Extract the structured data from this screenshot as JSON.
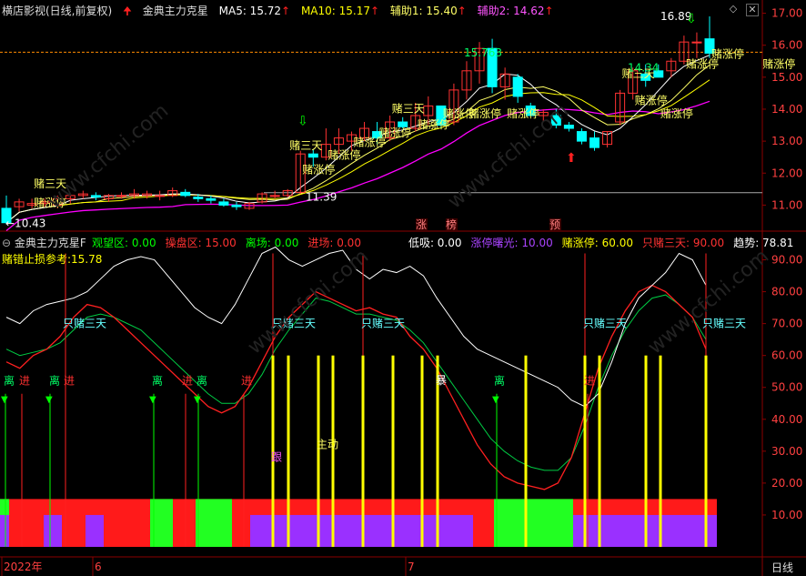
{
  "app_title": "横店影视(日线,前复权)",
  "main_panel": {
    "indicator_name": "金典主力克星",
    "ma5": "MA5: 15.72",
    "ma10": "MA10: 15.17",
    "aux1": "辅助1: 15.40",
    "aux2": "辅助2: 14.62",
    "y_ticks": [
      "17.00",
      "16.00",
      "15.00",
      "14.00",
      "13.00",
      "12.00",
      "11.00"
    ],
    "ylim": [
      10.3,
      17.3
    ],
    "horizontal_ref_level": 15.78,
    "support_level": 11.39,
    "max_label": "16.89",
    "min_label": "10.43",
    "mid_label": "15.763",
    "right_label": "14.34",
    "low_label": "11.39",
    "candles": [
      [
        10.9,
        11.3,
        10.4,
        10.45
      ],
      [
        10.95,
        11.2,
        10.8,
        11.1
      ],
      [
        11.0,
        11.2,
        10.9,
        11.05
      ],
      [
        11.05,
        11.2,
        10.95,
        11.1
      ],
      [
        11.0,
        11.3,
        10.9,
        11.2
      ],
      [
        11.2,
        11.35,
        11.05,
        11.3
      ],
      [
        11.3,
        11.45,
        11.2,
        11.35
      ],
      [
        11.3,
        11.4,
        11.15,
        11.25
      ],
      [
        11.2,
        11.35,
        11.1,
        11.3
      ],
      [
        11.3,
        11.4,
        11.2,
        11.3
      ],
      [
        11.3,
        11.5,
        11.2,
        11.35
      ],
      [
        11.3,
        11.45,
        11.2,
        11.35
      ],
      [
        11.3,
        11.45,
        11.15,
        11.3
      ],
      [
        11.3,
        11.55,
        11.25,
        11.45
      ],
      [
        11.4,
        11.5,
        11.25,
        11.3
      ],
      [
        11.25,
        11.35,
        11.1,
        11.2
      ],
      [
        11.2,
        11.3,
        11.05,
        11.15
      ],
      [
        11.1,
        11.2,
        10.95,
        11.0
      ],
      [
        11.0,
        11.1,
        10.85,
        10.95
      ],
      [
        10.9,
        11.1,
        10.85,
        11.05
      ],
      [
        11.1,
        11.4,
        11.05,
        11.35
      ],
      [
        11.3,
        11.45,
        11.2,
        11.3
      ],
      [
        11.3,
        11.5,
        11.25,
        11.45
      ],
      [
        11.4,
        12.7,
        11.35,
        12.6
      ],
      [
        12.6,
        12.75,
        12.2,
        12.5
      ],
      [
        12.5,
        13.4,
        12.4,
        12.9
      ],
      [
        12.9,
        13.4,
        12.6,
        13.1
      ],
      [
        13.0,
        13.3,
        12.7,
        13.2
      ],
      [
        13.1,
        13.6,
        13.0,
        13.4
      ],
      [
        13.3,
        13.6,
        12.9,
        13.1
      ],
      [
        13.1,
        13.8,
        13.0,
        13.6
      ],
      [
        13.6,
        13.75,
        13.4,
        13.45
      ],
      [
        13.4,
        14.2,
        13.3,
        13.8
      ],
      [
        13.8,
        14.4,
        13.5,
        14.1
      ],
      [
        14.1,
        14.1,
        13.4,
        13.5
      ],
      [
        13.6,
        14.8,
        13.5,
        14.6
      ],
      [
        14.6,
        15.5,
        14.3,
        15.2
      ],
      [
        15.2,
        16.1,
        14.8,
        15.9
      ],
      [
        15.9,
        16.2,
        14.5,
        14.7
      ],
      [
        14.7,
        15.3,
        14.3,
        15.1
      ],
      [
        15.0,
        15.1,
        14.2,
        14.4
      ],
      [
        14.1,
        14.2,
        13.8,
        13.8
      ],
      [
        13.8,
        14.0,
        13.6,
        13.9
      ],
      [
        13.8,
        14.0,
        13.4,
        13.5
      ],
      [
        13.5,
        13.6,
        13.3,
        13.4
      ],
      [
        13.3,
        13.4,
        12.9,
        13.0
      ],
      [
        13.1,
        13.3,
        12.7,
        12.8
      ],
      [
        12.9,
        13.3,
        12.8,
        13.3
      ],
      [
        13.6,
        14.6,
        13.5,
        14.5
      ],
      [
        14.5,
        15.3,
        14.3,
        15.2
      ],
      [
        15.1,
        15.4,
        14.7,
        14.9
      ],
      [
        15.2,
        15.4,
        15.0,
        15.0
      ],
      [
        15.2,
        15.6,
        15.0,
        15.5
      ],
      [
        15.5,
        16.3,
        15.4,
        16.1
      ],
      [
        16.1,
        16.4,
        15.6,
        16.1
      ],
      [
        16.2,
        16.9,
        15.6,
        15.75
      ]
    ],
    "signal_labels": [
      {
        "text": "赌三天",
        "i": 3,
        "p": 11.55
      },
      {
        "text": "赌涨停",
        "i": 3,
        "p": 10.95
      },
      {
        "text": "赌三天",
        "i": 23,
        "p": 12.75
      },
      {
        "text": "赌涨停",
        "i": 24,
        "p": 12.0
      },
      {
        "text": "赌涨停",
        "i": 26,
        "p": 12.45
      },
      {
        "text": "赌涨停",
        "i": 28,
        "p": 12.85
      },
      {
        "text": "赌涨停",
        "i": 30,
        "p": 13.15
      },
      {
        "text": "赌三天",
        "i": 31,
        "p": 13.9
      },
      {
        "text": "赌涨停",
        "i": 33,
        "p": 13.4
      },
      {
        "text": "赌涨停",
        "i": 35,
        "p": 13.75
      },
      {
        "text": "赌涨停",
        "i": 37,
        "p": 13.75
      },
      {
        "text": "赌涨停",
        "i": 40,
        "p": 13.75
      },
      {
        "text": "赌三天",
        "i": 49,
        "p": 15.0
      },
      {
        "text": "赌涨停",
        "i": 50,
        "p": 14.15
      },
      {
        "text": "赌涨停",
        "i": 54,
        "p": 15.3
      },
      {
        "text": "赌涨停",
        "i": 56,
        "p": 15.6
      },
      {
        "text": "赌涨停",
        "i": 60,
        "p": 15.3
      },
      {
        "text": "赌涨停",
        "i": 52,
        "p": 13.75
      }
    ],
    "markers": [
      {
        "text": "涨",
        "x": 463
      },
      {
        "text": "榜",
        "x": 496
      },
      {
        "text": "预",
        "x": 610
      }
    ],
    "colors": {
      "up": "#ff3232",
      "down": "#00ffff",
      "ma5": "#ffffff",
      "ma10": "#ffff00",
      "aux1": "#ffff66",
      "aux2": "#ff00ff",
      "grid": "#8b0000",
      "ref": "#ff8c00"
    }
  },
  "sub_panel": {
    "indicator_name": "金典主力克星F",
    "fields": [
      {
        "label": "观望区: 0.00",
        "color": "#00ff00"
      },
      {
        "label": "操盘区: 15.00",
        "color": "#ff3232"
      },
      {
        "label": "离场: 0.00",
        "color": "#00ff00"
      },
      {
        "label": "进场: 0.00",
        "color": "#ff3232"
      },
      {
        "label": "低吸: 0.00",
        "color": "#ffffff"
      },
      {
        "label": "涨停曙光: 10.00",
        "color": "#aa44ff"
      },
      {
        "label": "赌涨停: 60.00",
        "color": "#ffff00"
      },
      {
        "label": "只赌三天: 90.00",
        "color": "#ff3232"
      },
      {
        "label": "趋势: 78.81",
        "color": "#ffffff"
      }
    ],
    "stop_ref": "赌错止损参考:15.78",
    "y_ticks": [
      "90.00",
      "80.00",
      "70.00",
      "60.00",
      "50.00",
      "40.00",
      "30.00",
      "20.00",
      "10.00"
    ],
    "ylim": [
      -2,
      95
    ],
    "trend_white": [
      72,
      70,
      74,
      76,
      77,
      78,
      80,
      84,
      88,
      90,
      91,
      90,
      85,
      80,
      75,
      72,
      70,
      76,
      84,
      92,
      94,
      90,
      88,
      90,
      92,
      93,
      87,
      84,
      87,
      86,
      88,
      85,
      78,
      72,
      66,
      62,
      60,
      58,
      56,
      54,
      52,
      50,
      46,
      44,
      48,
      58,
      70,
      78,
      82,
      86,
      92,
      90,
      82
    ],
    "line_red": [
      58,
      56,
      60,
      62,
      66,
      72,
      76,
      75,
      72,
      68,
      64,
      60,
      56,
      52,
      48,
      44,
      42,
      44,
      50,
      58,
      66,
      72,
      76,
      80,
      78,
      76,
      74,
      75,
      73,
      72,
      66,
      62,
      56,
      48,
      40,
      32,
      26,
      22,
      20,
      19,
      18,
      20,
      28,
      42,
      56,
      66,
      74,
      80,
      82,
      80,
      76,
      72,
      62
    ],
    "line_green": [
      62,
      60,
      61,
      62,
      64,
      68,
      72,
      73,
      72,
      70,
      68,
      64,
      60,
      56,
      52,
      48,
      45,
      45,
      48,
      54,
      62,
      68,
      73,
      78,
      77,
      75,
      73,
      73,
      72,
      71,
      68,
      64,
      58,
      52,
      46,
      40,
      34,
      30,
      27,
      25,
      24,
      24,
      28,
      38,
      50,
      60,
      68,
      74,
      78,
      79,
      76,
      72,
      65
    ],
    "labels_sanTian": [
      {
        "text": "只赌三天",
        "x": 95
      },
      {
        "text": "只赌三天",
        "x": 325
      },
      {
        "text": "只赌三天",
        "x": 423
      },
      {
        "text": "只赌三天",
        "x": 667
      },
      {
        "text": "只赌三天",
        "x": 798
      }
    ],
    "labels_li": [
      {
        "text": "离",
        "x": 10
      },
      {
        "text": "离",
        "x": 60
      },
      {
        "text": "离",
        "x": 173
      },
      {
        "text": "离",
        "x": 222
      },
      {
        "text": "离",
        "x": 549
      }
    ],
    "labels_jin": [
      {
        "text": "进",
        "x": 27
      },
      {
        "text": "进",
        "x": 76
      },
      {
        "text": "进",
        "x": 206
      },
      {
        "text": "进",
        "x": 271
      },
      {
        "text": "进",
        "x": 648
      }
    ],
    "label_bao": "暴",
    "label_gen": "跟",
    "label_zhudong": "主动",
    "yellow_bars_x": [
      300,
      317,
      350,
      366,
      399,
      432,
      464,
      481,
      578,
      643,
      659,
      710,
      726,
      776
    ],
    "red_lines_x": [
      72,
      300,
      399,
      643,
      776
    ],
    "green_lines_x": [
      6,
      55,
      169,
      218,
      546
    ],
    "red_vlines_short_x": [
      24,
      72,
      204,
      268,
      646
    ]
  },
  "time_axis": {
    "labels": [
      {
        "text": "2022年",
        "x": 4
      },
      {
        "text": "6",
        "x": 104
      },
      {
        "text": "7",
        "x": 448
      }
    ],
    "period": "日线"
  }
}
